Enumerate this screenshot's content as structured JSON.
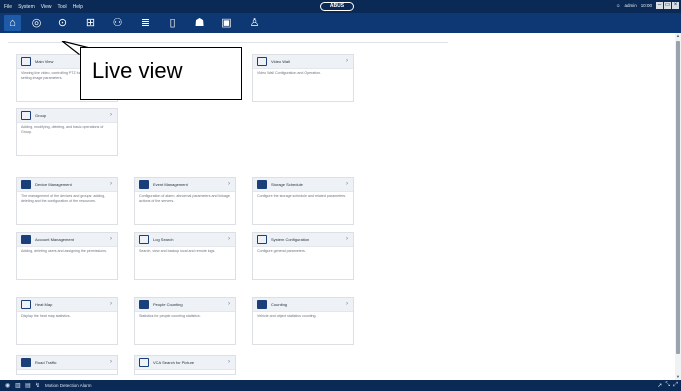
{
  "menubar": {
    "items": [
      "File",
      "System",
      "View",
      "Tool",
      "Help"
    ],
    "brand": "ABUS",
    "right_text": [
      "admin",
      "10:00"
    ]
  },
  "toolbar": {
    "buttons": [
      {
        "name": "home-icon",
        "glyph": "⌂"
      },
      {
        "name": "camera-icon",
        "glyph": "◎"
      },
      {
        "name": "playback-icon",
        "glyph": "⊙"
      },
      {
        "name": "video-wall-icon",
        "glyph": "⊞"
      },
      {
        "name": "group-icon",
        "glyph": "⚇"
      },
      {
        "name": "database-icon",
        "glyph": "≣"
      },
      {
        "name": "storage-icon",
        "glyph": "▯"
      },
      {
        "name": "account-icon",
        "glyph": "☗"
      },
      {
        "name": "monitor-icon",
        "glyph": "▣"
      },
      {
        "name": "person-icon",
        "glyph": "♙"
      }
    ]
  },
  "cards": {
    "live_view": {
      "title": "Main View",
      "desc": "Viewing live video, controlling PTZ functionality and setting image parameters."
    },
    "video_wall": {
      "title": "Video Wall",
      "desc": "Video Wall Configuration and Operation."
    },
    "group": {
      "title": "Group",
      "desc": "Adding, modifying, deleting, and basic operations of Group."
    },
    "device_mgmt": {
      "title": "Device Management",
      "desc": "The management of the devices and groups: adding, deleting and the configuration of the resources."
    },
    "event_mgmt": {
      "title": "Event Management",
      "desc": "Configuration of alarm, abnormal parameters and linkage actions of the servers."
    },
    "storage_schedule": {
      "title": "Storage Schedule",
      "desc": "Configure the storage schedule and related parameters."
    },
    "account_mgmt": {
      "title": "Account Management",
      "desc": "Adding, deleting users and assigning the permissions."
    },
    "log_search": {
      "title": "Log Search",
      "desc": "Search, view and backup local and remote logs."
    },
    "system_config": {
      "title": "System Configuration",
      "desc": "Configure general parameters."
    },
    "heat_map": {
      "title": "Heat Map",
      "desc": "Display the heat map statistics."
    },
    "people_counting": {
      "title": "People Counting",
      "desc": "Statistics for people counting statistics."
    },
    "counting": {
      "title": "Counting",
      "desc": "Vehicle and object statistics counting."
    },
    "road_traffic": {
      "title": "Road Traffic",
      "desc": ""
    },
    "vca_search": {
      "title": "VCA Search for Picture",
      "desc": ""
    }
  },
  "callout": {
    "text": "Live view"
  },
  "statusbar": {
    "text": "Motion Detection Alarm"
  }
}
